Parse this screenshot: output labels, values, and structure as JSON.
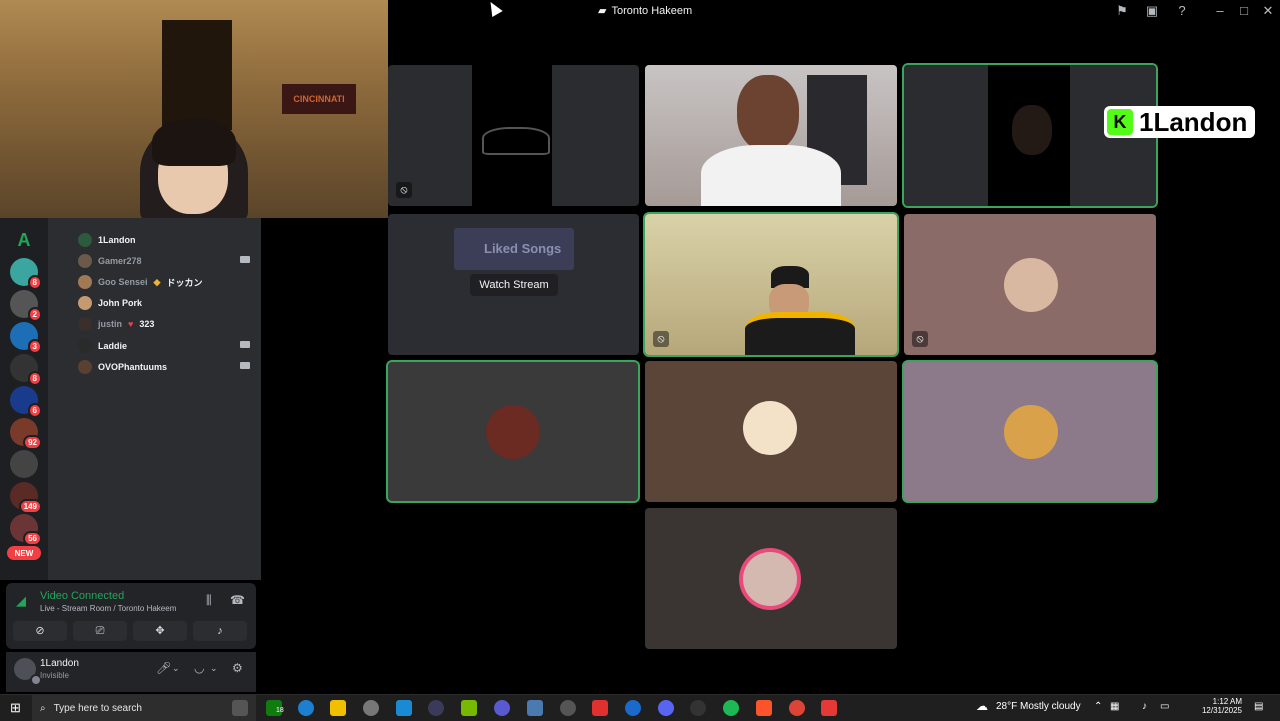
{
  "window": {
    "title": "Toronto Hakeem"
  },
  "titlebar_icons": [
    "inbox-icon",
    "screen-share-icon",
    "help-icon",
    "minimize-icon",
    "maximize-icon",
    "close-icon"
  ],
  "server_badges": [
    "8",
    "2",
    "3",
    "8",
    "6",
    "92",
    "149",
    "56"
  ],
  "servers_new_label": "NEW",
  "webcam_banner": "CINCINNATI",
  "members": [
    {
      "name": "1Landon",
      "active": true,
      "camera": false,
      "extra": ""
    },
    {
      "name": "Gamer278",
      "active": false,
      "camera": true,
      "extra": ""
    },
    {
      "name": "Goo Sensei",
      "active": false,
      "camera": false,
      "extra": "ドッカン"
    },
    {
      "name": "John Pork",
      "active": true,
      "camera": false,
      "extra": ""
    },
    {
      "name": "justin",
      "active": false,
      "camera": false,
      "extra": "323"
    },
    {
      "name": "Laddie",
      "active": true,
      "camera": true,
      "extra": ""
    },
    {
      "name": "OVOPhantuums",
      "active": true,
      "camera": true,
      "extra": ""
    }
  ],
  "voice": {
    "status": "Video Connected",
    "location": "Live - Stream Room / Toronto Hakeem"
  },
  "user": {
    "name": "1Landon",
    "status": "Invisible"
  },
  "stream": {
    "watch_label": "Watch Stream",
    "preview_title": "Liked Songs"
  },
  "overlay_tag": {
    "prefix": "K",
    "name": "1Landon"
  },
  "taskbar": {
    "search_placeholder": "Type here to search",
    "xbox_badge": "18",
    "weather": "28°F  Mostly cloudy",
    "time": "1:12 AM",
    "date": "12/31/2025"
  },
  "colors": {
    "accent_green": "#3ba55d",
    "discord_dark": "#1e1f22",
    "panel": "#2b2d31"
  }
}
